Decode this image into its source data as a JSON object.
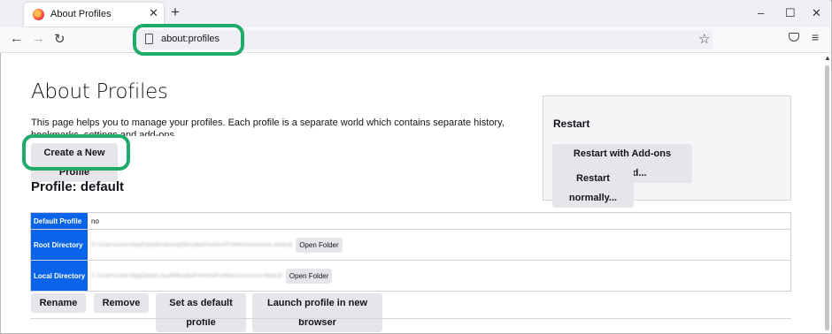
{
  "tab": {
    "title": "About Profiles",
    "close": "✕",
    "new_tab": "+"
  },
  "window_controls": {
    "minimize": "–",
    "maximize": "☐",
    "close": "✕"
  },
  "toolbar": {
    "back": "←",
    "forward": "→",
    "reload": "↻",
    "url": "about:profiles",
    "bookmark": "☆",
    "menu": "≡"
  },
  "page": {
    "title": "About Profiles",
    "intro": "This page helps you to manage your profiles. Each profile is a separate world which contains separate history, bookmarks, settings and add-ons.",
    "create_button": "Create a New Profile",
    "profile_heading": "Profile: default"
  },
  "restart": {
    "title": "Restart",
    "disabled_addons_button": "Restart with Add-ons Disabled...",
    "normal_button": "Restart normally..."
  },
  "profile_table": {
    "rows": [
      {
        "label": "Default Profile",
        "value": "no"
      },
      {
        "label": "Root Directory",
        "value": "C:\\Users\\user\\AppData\\Roaming\\Mozilla\\Firefox\\Profiles\\xxxxxxxx.default",
        "button": "Open Folder"
      },
      {
        "label": "Local Directory",
        "value": "C:\\Users\\user\\AppData\\Local\\Mozilla\\Firefox\\Profiles\\xxxxxxxx.default",
        "button": "Open Folder"
      }
    ]
  },
  "actions": {
    "rename": "Rename",
    "remove": "Remove",
    "set_default": "Set as default profile",
    "launch": "Launch profile in new browser"
  },
  "colors": {
    "highlight": "#1fab6a",
    "label_bg": "#0a64ea"
  }
}
